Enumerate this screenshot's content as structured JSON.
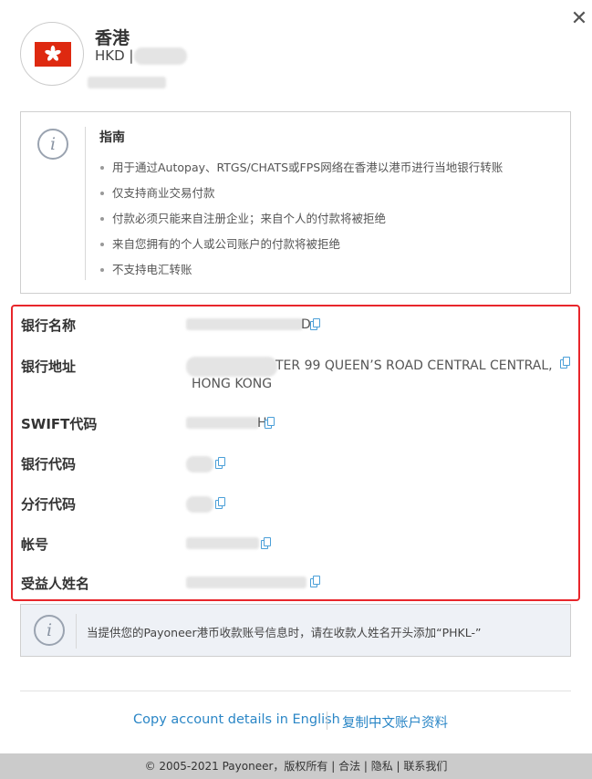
{
  "header": {
    "title": "香港",
    "currency_prefix": "HKD |",
    "close_glyph": "✕"
  },
  "guide": {
    "icon_glyph": "i",
    "title": "指南",
    "items": [
      "用于通过Autopay、RTGS/CHATS或FPS网络在香港以港币进行当地银行转账",
      "仅支持商业交易付款",
      "付款必须只能来自注册企业；来自个人的付款将被拒绝",
      "来自您拥有的个人或公司账户的付款将被拒绝",
      "不支持电汇转账"
    ]
  },
  "details": {
    "rows": [
      {
        "label": "银行名称",
        "value_visible": "D"
      },
      {
        "label": "银行地址",
        "value_visible": "TER 99 QUEEN’S ROAD CENTRAL CENTRAL,",
        "value_line2": "HONG KONG"
      },
      {
        "label": "SWIFT代码",
        "value_visible": "H"
      },
      {
        "label": "银行代码",
        "value_visible": ""
      },
      {
        "label": "分行代码",
        "value_visible": ""
      },
      {
        "label": "帐号",
        "value_visible": ""
      },
      {
        "label": "受益人姓名",
        "value_visible": ""
      }
    ]
  },
  "notice": {
    "icon_glyph": "i",
    "text": "当提供您的Payoneer港币收款账号信息时，请在收款人姓名开头添加“PHKL-”"
  },
  "links": {
    "copy_english": "Copy account details in English",
    "copy_chinese": "复制中文账户资料"
  },
  "footer": {
    "text": "© 2005-2021 Payoneer，版权所有 | 合法 | 隐私 | 联系我们"
  },
  "colors": {
    "highlight_border": "#e8262b",
    "link": "#2a86c6",
    "flag_red": "#de2910",
    "footer_bg": "#cbcbcb"
  }
}
